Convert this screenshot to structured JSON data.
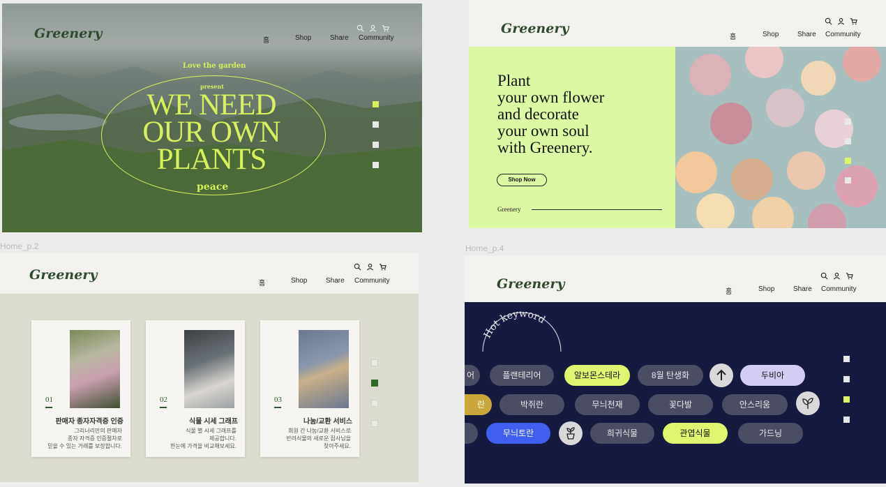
{
  "labels": {
    "home_p2": "Home_p.2",
    "home_p4": "Home_p.4"
  },
  "nav": {
    "logo": "Greenery",
    "home": "홈",
    "shop": "Shop",
    "share": "Share",
    "community": "Community"
  },
  "hero": {
    "top_line": "Love the garden",
    "present": "present",
    "title": "WE NEED OUR OWN PLANTS",
    "bottom_line": "peace"
  },
  "plant": {
    "headline": [
      "Plant",
      "your own flower",
      "and decorate",
      "your own soul",
      "with Greenery."
    ],
    "button": "Shop Now",
    "footer_brand": "Greenery"
  },
  "cards": [
    {
      "num": "01",
      "title": "판매자 종자자격증 인증",
      "desc": [
        "그리너리만의 판매자",
        "종자 자격증 인증절차로",
        "믿을 수 있는 거래를 보장합니다."
      ]
    },
    {
      "num": "02",
      "title": "식물 시세 그래프",
      "desc": [
        "식물 별 시세 그래프를",
        "제공합니다.",
        "한눈에 가격을 비교해보세요."
      ]
    },
    {
      "num": "03",
      "title": "나눔/교환 서비스",
      "desc": [
        "회원 간 나눔/교환 서비스로",
        "반려식물의 새로운 집사님을",
        "찾아주세요."
      ]
    }
  ],
  "keywords": {
    "title": "Hot keyword",
    "row1": [
      "어",
      "플랜테리어",
      "알보몬스테라",
      "8월 탄생화",
      "두비아"
    ],
    "row2": [
      "란",
      "박쥐란",
      "무늬천재",
      "꽃다발",
      "안스리움"
    ],
    "row3": [
      "무늬토란",
      "희귀식물",
      "관엽식물",
      "가드닝"
    ]
  },
  "colors": {
    "lime": "#d7f05c",
    "navy": "#161a3f",
    "dark_green": "#2f4a2f"
  },
  "icons": [
    "search-icon",
    "user-icon",
    "cart-icon",
    "arrow-up-icon",
    "leaf-icon",
    "potted-plant-icon"
  ]
}
